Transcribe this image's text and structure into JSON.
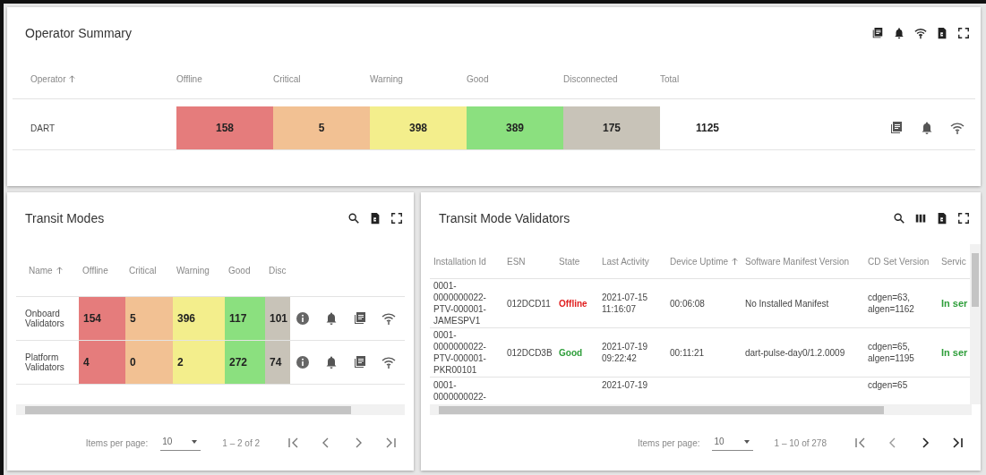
{
  "operator_summary": {
    "title": "Operator Summary",
    "columns": [
      {
        "label": "Operator",
        "sorted": true
      },
      {
        "label": "Offline",
        "color": "#e57c7c"
      },
      {
        "label": "Critical",
        "color": "#f2c193"
      },
      {
        "label": "Warning",
        "color": "#f3ee8c"
      },
      {
        "label": "Good",
        "color": "#8be07f"
      },
      {
        "label": "Disconnected",
        "color": "#c8c3b8"
      },
      {
        "label": "Total",
        "sorted": false
      }
    ],
    "rows": [
      {
        "name": "DART",
        "values": [
          "158",
          "5",
          "398",
          "389",
          "175"
        ],
        "total": "1125"
      }
    ]
  },
  "transit_modes": {
    "title": "Transit Modes",
    "columns": [
      {
        "label": "Name",
        "sorted": true
      },
      {
        "label": "Offline",
        "color": "#e57c7c"
      },
      {
        "label": "Critical",
        "color": "#f2c193"
      },
      {
        "label": "Warning",
        "color": "#f3ee8c"
      },
      {
        "label": "Good",
        "color": "#8be07f"
      },
      {
        "label": "Disc",
        "color": "#c8c3b8"
      }
    ],
    "rows": [
      {
        "name": "Onboard Validators",
        "values": [
          "154",
          "5",
          "396",
          "117",
          "101"
        ]
      },
      {
        "name": "Platform Validators",
        "values": [
          "4",
          "0",
          "2",
          "272",
          "74"
        ]
      }
    ],
    "paginator": {
      "items_label": "Items per page:",
      "page_size": "10",
      "range": "1 – 2 of 2"
    }
  },
  "validators": {
    "title": "Transit Mode Validators",
    "columns": [
      {
        "label": "Installation Id",
        "sorted": false
      },
      {
        "label": "ESN",
        "sorted": false
      },
      {
        "label": "State",
        "sorted": false
      },
      {
        "label": "Last Activity",
        "sorted": false
      },
      {
        "label": "Device Uptime",
        "sorted": true
      },
      {
        "label": "Software Manifest Version",
        "sorted": false
      },
      {
        "label": "CD Set Version",
        "sorted": false
      },
      {
        "label": "Servic"
      }
    ],
    "rows": [
      {
        "installation_id": "0001-0000000022-PTV-000001-JAMESPV1",
        "esn": "012DCD11",
        "state": {
          "label": "Offline",
          "color": "#e02020"
        },
        "last_activity": "2021-07-15 11:16:07",
        "uptime": "00:06:08",
        "manifest": "No Installed Manifest",
        "cd_set": "cdgen=63, algen=1162",
        "service": {
          "label": "In ser",
          "color": "#2e9e3a"
        }
      },
      {
        "installation_id": "0001-0000000022-PTV-000001-PKR00101",
        "esn": "012DCD3B",
        "state": {
          "label": "Good",
          "color": "#2e9e3a"
        },
        "last_activity": "2021-07-19 09:22:42",
        "uptime": "00:11:21",
        "manifest": "dart-pulse-day0/1.2.0009",
        "cd_set": "cdgen=65, algen=1195",
        "service": {
          "label": "In ser",
          "color": "#2e9e3a"
        }
      },
      {
        "installation_id": "0001-0000000022-",
        "last_activity": "2021-07-19",
        "cd_set": "cdgen=65"
      }
    ],
    "paginator": {
      "items_label": "Items per page:",
      "page_size": "10",
      "range": "1 – 10 of 278"
    }
  }
}
